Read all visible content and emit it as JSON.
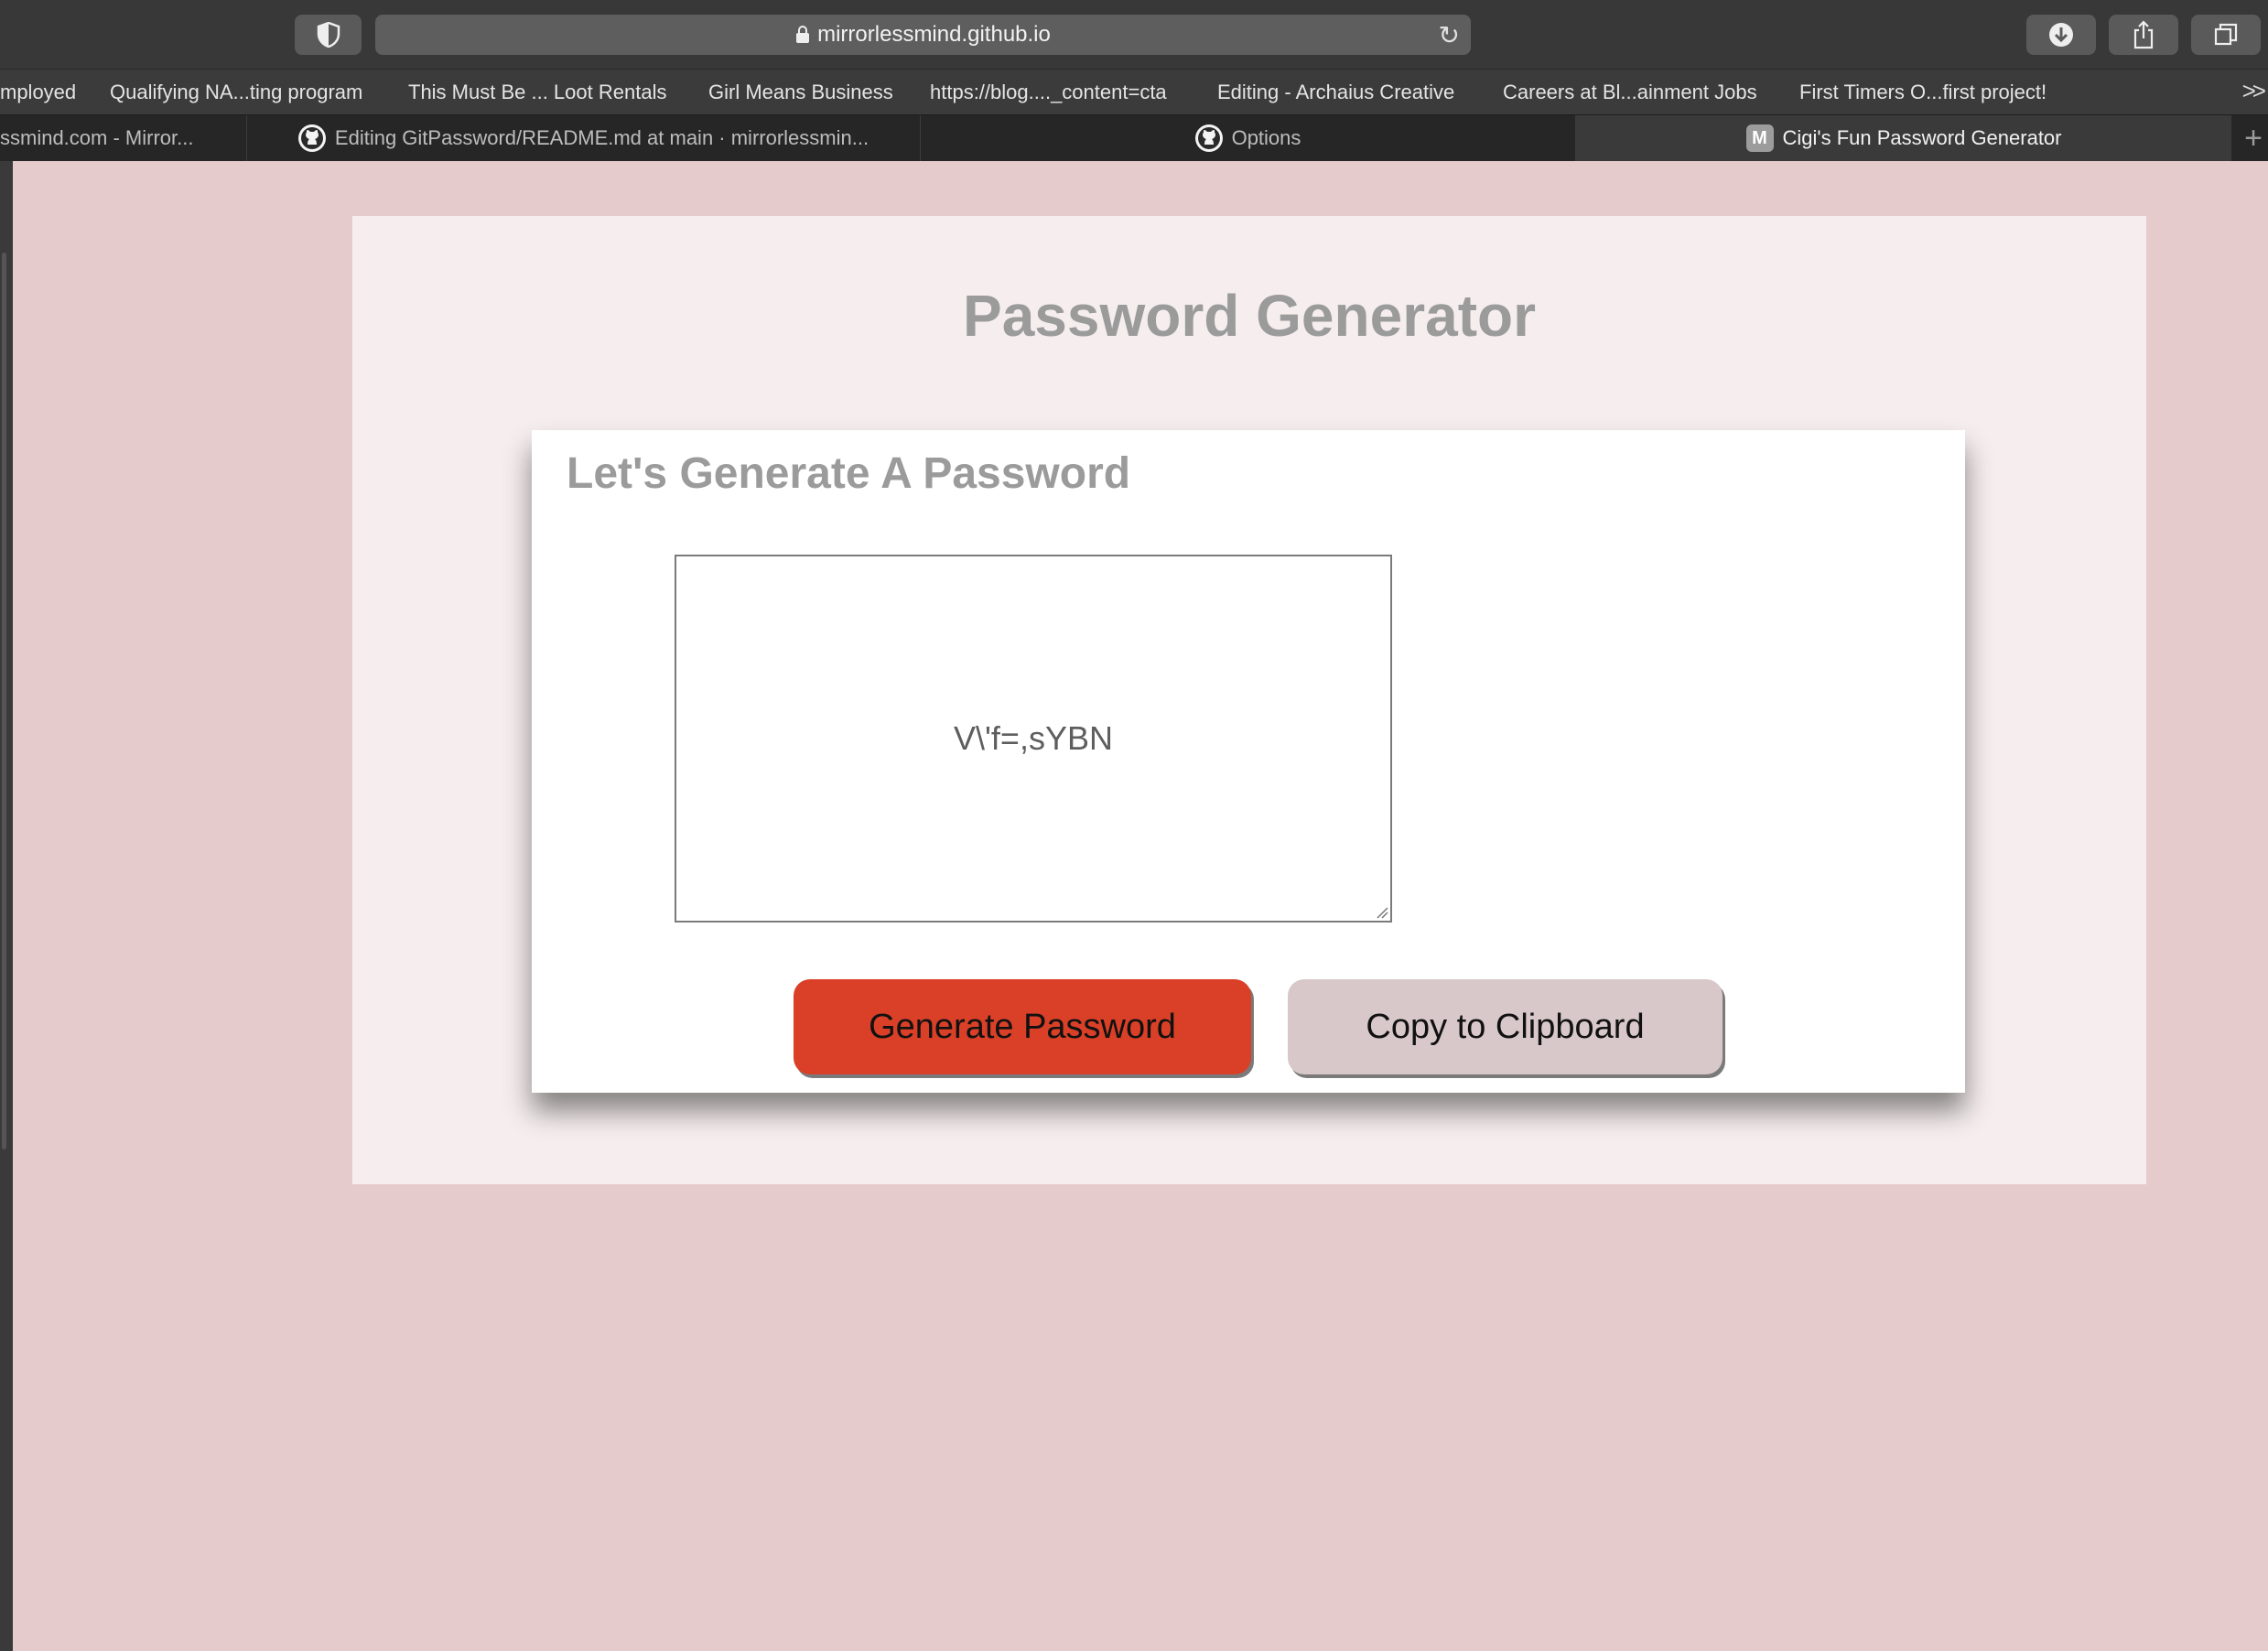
{
  "browser": {
    "url": "mirrorlessmind.github.io",
    "bookmarks": [
      "mployed",
      "Qualifying NA...ting program",
      "This Must Be ... Loot Rentals",
      "Girl Means Business",
      "https://blog...._content=cta",
      "Editing - Archaius Creative",
      "Careers at Bl...ainment Jobs",
      "First Timers O...first project!"
    ],
    "bookmarks_more": ">>",
    "tabs": [
      {
        "label": "ssmind.com - Mirror...",
        "icon": "none"
      },
      {
        "label": "Editing GitPassword/README.md at main · mirrorlessmin...",
        "icon": "github-icon"
      },
      {
        "label": "Options",
        "icon": "github-icon"
      },
      {
        "label": "Cigi's Fun Password Generator",
        "icon": "M",
        "active": true
      }
    ],
    "new_tab": "+"
  },
  "page": {
    "title": "Password Generator",
    "card_title": "Let's Generate A Password",
    "password_value": "V\\'f=,sYBN",
    "generate_label": "Generate Password",
    "copy_label": "Copy to Clipboard"
  },
  "colors": {
    "page_bg": "#e6cbcc",
    "wrapper_bg": "#f6eeee",
    "generate_btn": "#d94027",
    "copy_btn": "#d9c8c9",
    "heading": "#9b9b9b"
  }
}
